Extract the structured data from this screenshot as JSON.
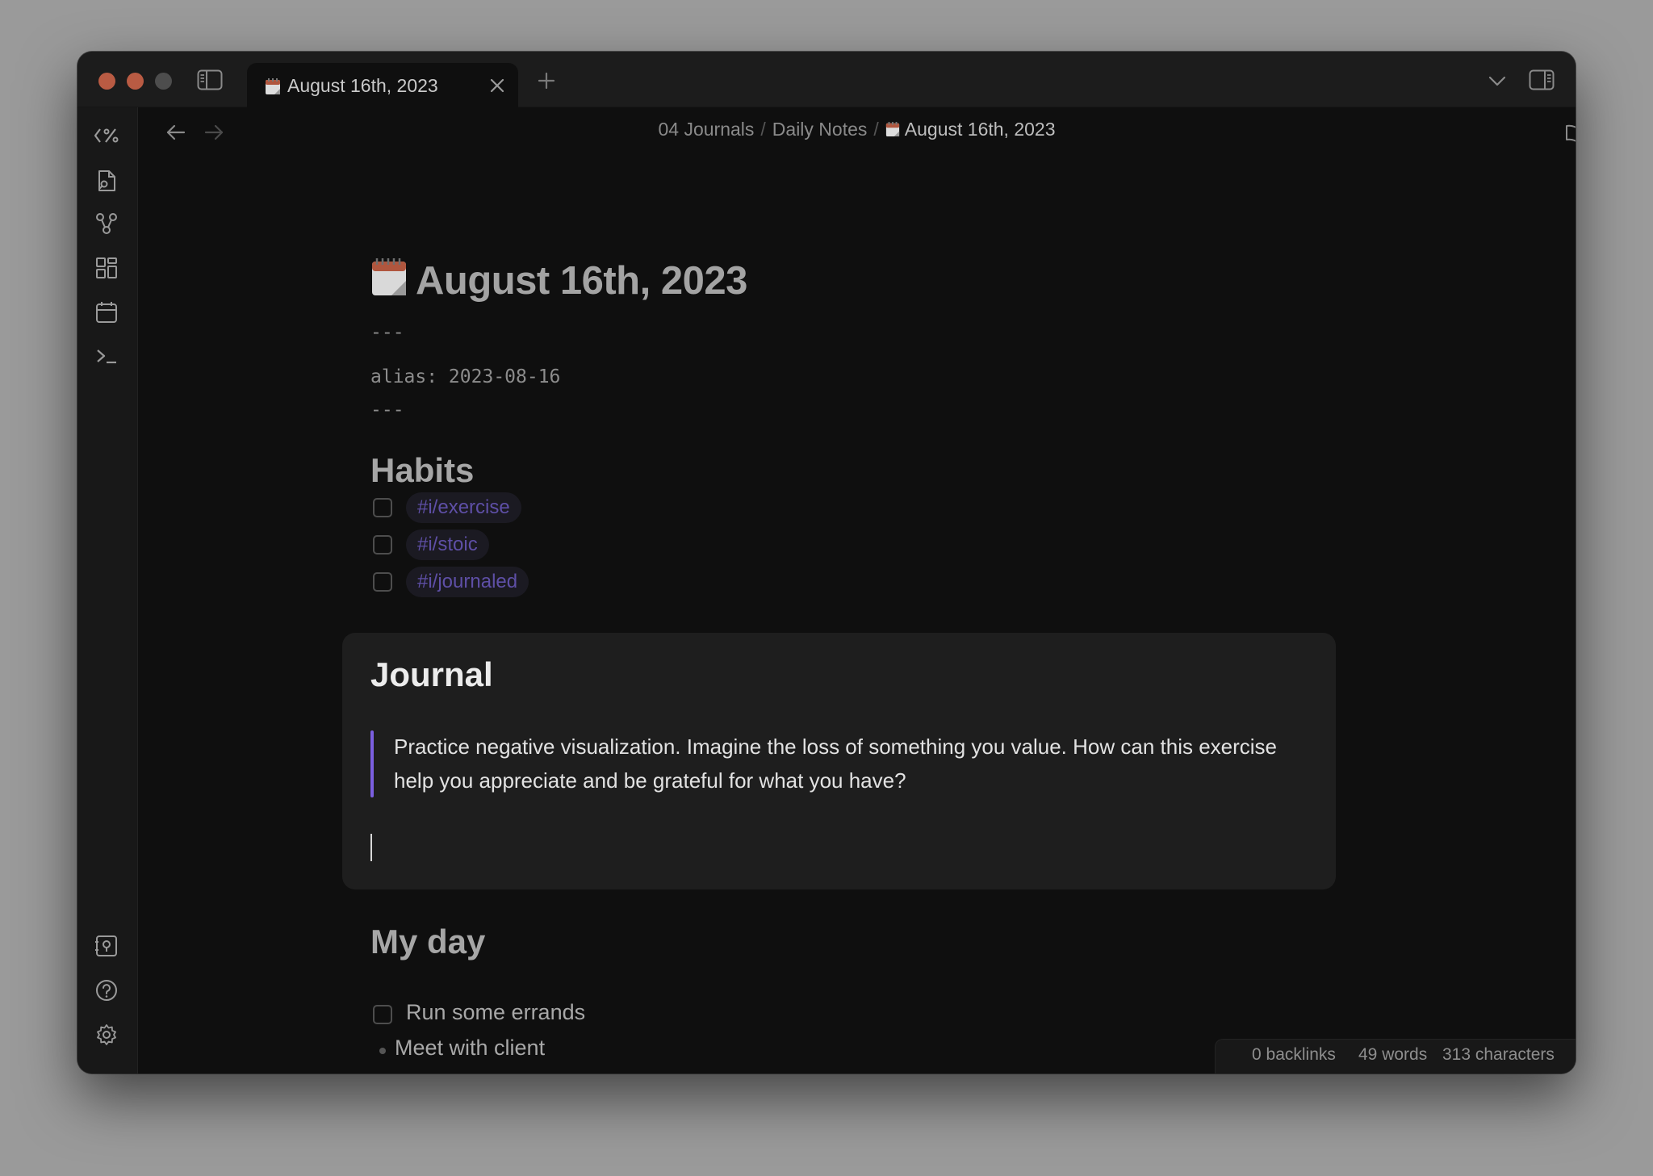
{
  "window": {
    "tab": {
      "emoji": "🗓️",
      "title": "August 16th, 2023"
    }
  },
  "breadcrumb": {
    "parts": [
      "04 Journals",
      "Daily Notes"
    ],
    "separator": "/",
    "current": "August 16th, 2023",
    "current_emoji": "🗓️"
  },
  "note": {
    "title_emoji": "🗓️",
    "title": "August 16th, 2023",
    "frontmatter": {
      "open": "---",
      "line": "alias: 2023-08-16",
      "close": "---"
    },
    "habits": {
      "heading": "Habits",
      "items": [
        {
          "tag": "#i/exercise",
          "checked": false
        },
        {
          "tag": "#i/stoic",
          "checked": false
        },
        {
          "tag": "#i/journaled",
          "checked": false
        }
      ]
    },
    "journal": {
      "heading": "Journal",
      "quote": "Practice negative visualization. Imagine the loss of something you value. How can this exercise help you appreciate and be grateful for what you have?"
    },
    "my_day": {
      "heading": "My day",
      "task": {
        "label": "Run some errands",
        "checked": false
      },
      "bullet": "Meet with client"
    }
  },
  "status": {
    "backlinks": "0 backlinks",
    "words": "49 words",
    "characters": "313 characters"
  },
  "colors": {
    "accent": "#7b5fe0",
    "tag_text": "#5e4fa6",
    "traffic_red": "#b95b43",
    "background": "#0f0f0f"
  }
}
